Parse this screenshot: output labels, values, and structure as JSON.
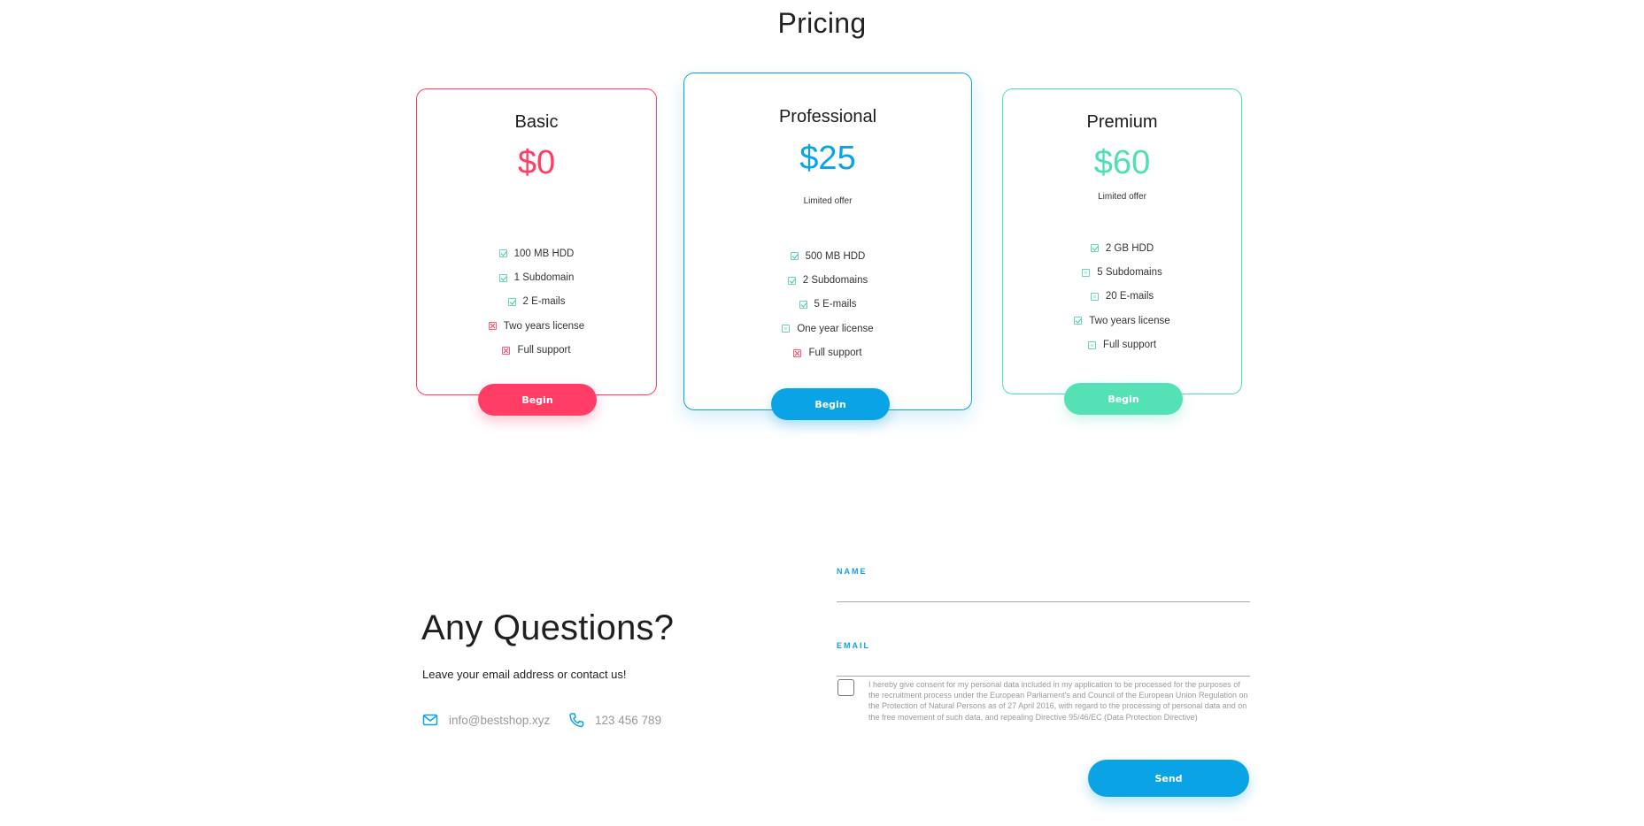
{
  "pricing": {
    "title": "Pricing",
    "plans": [
      {
        "name": "Basic",
        "price": "$0",
        "note": "",
        "accent": "#ff3d65",
        "features": [
          {
            "label": "100 MB HDD",
            "icon": "check-icon"
          },
          {
            "label": "1 Subdomain",
            "icon": "check-icon"
          },
          {
            "label": "2 E-mails",
            "icon": "check-icon"
          },
          {
            "label": "Two years license",
            "icon": "cross-icon"
          },
          {
            "label": "Full support",
            "icon": "cross-icon"
          }
        ],
        "button": "Begin"
      },
      {
        "name": "Professional",
        "price": "$25",
        "note": "Limited offer",
        "accent": "#0aa3e6",
        "features": [
          {
            "label": "500 MB HDD",
            "icon": "check-icon"
          },
          {
            "label": "2 Subdomains",
            "icon": "check-icon"
          },
          {
            "label": "5 E-mails",
            "icon": "check-icon"
          },
          {
            "label": "One year license",
            "icon": "square-icon"
          },
          {
            "label": "Full support",
            "icon": "cross-icon"
          }
        ],
        "button": "Begin"
      },
      {
        "name": "Premium",
        "price": "$60",
        "note": "Limited offer",
        "accent": "#4ee0b4",
        "features": [
          {
            "label": "2 GB HDD",
            "icon": "check-icon"
          },
          {
            "label": "5 Subdomains",
            "icon": "square-icon"
          },
          {
            "label": "20 E-mails",
            "icon": "square-icon"
          },
          {
            "label": "Two years license",
            "icon": "check-icon"
          },
          {
            "label": "Full support",
            "icon": "square-icon"
          }
        ],
        "button": "Begin"
      }
    ]
  },
  "contact": {
    "title": "Any Questions?",
    "subtitle": "Leave your email address or contact us!",
    "email": "info@bestshop.xyz",
    "phone": "123 456 789",
    "email_icon": "mail-icon",
    "phone_icon": "phone-icon"
  },
  "form": {
    "name_label": "NAME",
    "name_value": "",
    "email_label": "EMAIL",
    "email_value": "",
    "consent_text": "I hereby give consent for my personal data included in my application to be processed for the purposes of the recruitment process under the European Parliament's and Council of the European Union Regulation on the Protection of Natural Persons as of 27 April 2016, with regard to the processing of personal data and on the free movement of such data, and repealing Directive 95/46/EC (Data Protection Directive)",
    "consent_checked": false,
    "send_label": "Send"
  }
}
